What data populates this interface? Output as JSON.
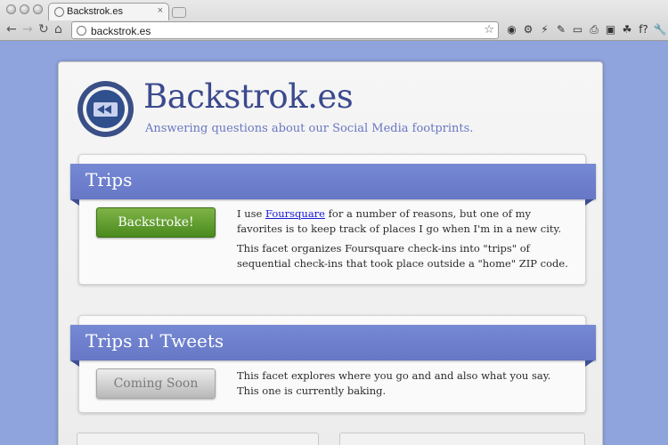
{
  "browser": {
    "tab_title": "Backstrok.es",
    "tab_close": "×",
    "address": "backstrok.es",
    "nav": {
      "back": "←",
      "forward": "→",
      "reload": "↻",
      "home": "⌂"
    },
    "bookmark_star": "☆",
    "extensions": [
      {
        "name": "octocat-icon",
        "glyph": "◉"
      },
      {
        "name": "gear-extension-icon",
        "glyph": "⚙"
      },
      {
        "name": "bolt-extension-icon",
        "glyph": "⚡"
      },
      {
        "name": "eyedropper-icon",
        "glyph": "✎"
      },
      {
        "name": "window-resize-icon",
        "glyph": "▭"
      },
      {
        "name": "print-icon",
        "glyph": "⎙"
      },
      {
        "name": "package-icon",
        "glyph": "▣"
      },
      {
        "name": "android-icon",
        "glyph": "☘"
      },
      {
        "name": "function-icon",
        "glyph": "f?"
      },
      {
        "name": "wrench-icon",
        "glyph": "🔧"
      }
    ]
  },
  "site": {
    "title": "Backstrok.es",
    "tagline": "Answering questions about our Social Media footprints."
  },
  "sections": [
    {
      "title": "Trips",
      "button": "Backstroke!",
      "p1_pre": "I use ",
      "p1_link": "Foursquare",
      "p1_post": " for a number of reasons, but one of my favorites is to keep track of places I go when I'm in a new city.",
      "p2": "This facet organizes Foursquare check-ins into \"trips\" of sequential check-ins that took place outside a \"home\" ZIP code."
    },
    {
      "title": "Trips n' Tweets",
      "button": "Coming Soon",
      "p1": "This facet explores where you go and and also what you say. This one is currently baking."
    }
  ],
  "colors": {
    "background": "#8fa3dd",
    "banner": "#6f81cf",
    "title": "#3b4a8e",
    "tagline": "#6977c1",
    "green_button": "#5b9a2c"
  }
}
